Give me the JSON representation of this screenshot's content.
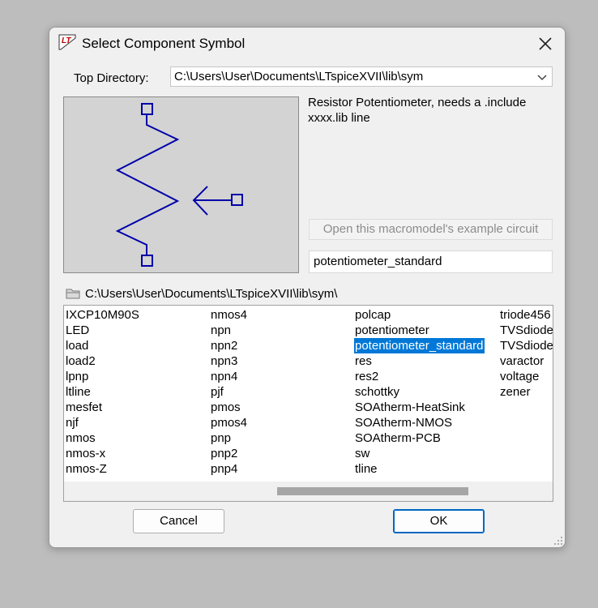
{
  "window": {
    "title": "Select Component Symbol",
    "close_icon": "close-icon"
  },
  "top_directory": {
    "label": "Top Directory:",
    "value": "C:\\Users\\User\\Documents\\LTspiceXVII\\lib\\sym"
  },
  "preview": {
    "description": "Resistor Potentiometer, needs a .include xxxx.lib line",
    "example_button": "Open this macromodel's example circuit",
    "symbol_name": "potentiometer_standard",
    "symbol_color": "#0000aa"
  },
  "current_path": "C:\\Users\\User\\Documents\\LTspiceXVII\\lib\\sym\\",
  "list": {
    "columns": [
      [
        "IXCP10M90S",
        "LED",
        "load",
        "load2",
        "lpnp",
        "ltline",
        "mesfet",
        "njf",
        "nmos",
        "nmos-x",
        "nmos-Z"
      ],
      [
        "nmos4",
        "npn",
        "npn2",
        "npn3",
        "npn4",
        "pjf",
        "pmos",
        "pmos4",
        "pnp",
        "pnp2",
        "pnp4"
      ],
      [
        "polcap",
        "potentiometer",
        "potentiometer_standard",
        "res",
        "res2",
        "schottky",
        "SOAtherm-HeatSink",
        "SOAtherm-NMOS",
        "SOAtherm-PCB",
        "sw",
        "tline"
      ],
      [
        "triode456",
        "TVSdiode",
        "TVSdiode",
        "varactor",
        "voltage",
        "zener"
      ]
    ],
    "selected": "potentiometer_standard",
    "selection_color": "#0078d7"
  },
  "buttons": {
    "cancel": "Cancel",
    "ok": "OK"
  }
}
